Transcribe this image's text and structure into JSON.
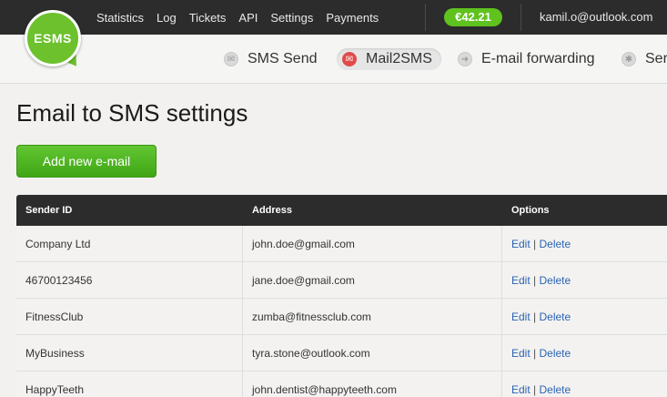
{
  "logo": {
    "text": "ESMS"
  },
  "topnav": {
    "items": [
      "Statistics",
      "Log",
      "Tickets",
      "API",
      "Settings",
      "Payments"
    ],
    "balance": "€42.21",
    "user_email": "kamil.o@outlook.com"
  },
  "subnav": {
    "tabs": [
      "SMS Send",
      "Mail2SMS",
      "E-mail forwarding",
      "Ser"
    ],
    "active": "Mail2SMS"
  },
  "page": {
    "title": "Email to SMS settings",
    "add_button": "Add new e-mail"
  },
  "table": {
    "headers": [
      "Sender ID",
      "Address",
      "Options"
    ],
    "edit_label": "Edit",
    "delete_label": "Delete",
    "separator": "|",
    "rows": [
      {
        "sender": "Company Ltd",
        "address": "john.doe@gmail.com"
      },
      {
        "sender": "46700123456",
        "address": "jane.doe@gmail.com"
      },
      {
        "sender": "FitnessClub",
        "address": "zumba@fitnessclub.com"
      },
      {
        "sender": "MyBusiness",
        "address": "tyra.stone@outlook.com"
      },
      {
        "sender": "HappyTeeth",
        "address": "john.dentist@happyteeth.com"
      }
    ]
  }
}
